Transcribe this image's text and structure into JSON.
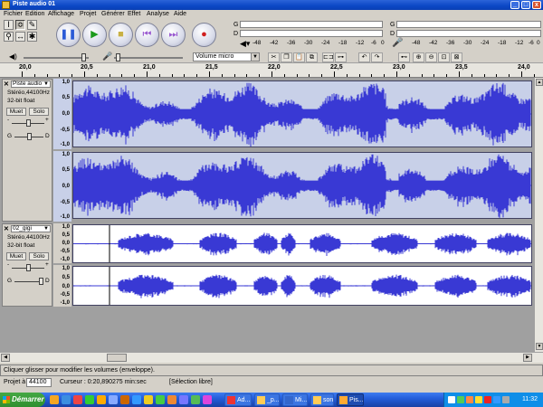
{
  "window": {
    "title": "Piste audio 01",
    "minimize": "_",
    "maximize": "□",
    "close": "x"
  },
  "menu": [
    "Fichier",
    "Edition",
    "Affichage",
    "Projet",
    "Générer",
    "Effet",
    "Analyse",
    "Aide"
  ],
  "transport": {
    "pause": "❚❚",
    "play": "▶",
    "stop": "■",
    "skip_start": "⏮",
    "skip_end": "⏭",
    "record": "●"
  },
  "meters": {
    "play_label": "G",
    "play_label2": "D",
    "rec_label": "G",
    "rec_label2": "D",
    "scale": [
      "-48",
      "-42",
      "-36",
      "-30",
      "-24",
      "-18",
      "-12",
      "-6",
      "0"
    ]
  },
  "mixer": {
    "input_source": "Volume micro"
  },
  "ruler": {
    "labels": [
      "20,0",
      "20,5",
      "21,0",
      "21,5",
      "22,0",
      "22,5",
      "23,0",
      "23,5",
      "24,0"
    ]
  },
  "tracks": [
    {
      "name": "Piste audio",
      "format": "Stéréo,44100Hz",
      "depth": "32-bit float",
      "mute": "Muet",
      "solo": "Solo",
      "pan_left": "G",
      "pan_right": "D",
      "gain_minus": "-",
      "gain_plus": "+",
      "scale": [
        "1,0",
        "0,5",
        "0,0",
        "-0,5",
        "-1,0"
      ]
    },
    {
      "name": "02_gigi",
      "format": "Stéréo,44100Hz",
      "depth": "32-bit float",
      "mute": "Muet",
      "solo": "Solo",
      "pan_left": "G",
      "pan_right": "D",
      "gain_minus": "-",
      "gain_plus": "+",
      "scale": [
        "1,0",
        "0,5",
        "0,0",
        "-0,5",
        "-1,0"
      ]
    }
  ],
  "status": {
    "message": "Cliquer glisser pour modifier les volumes (enveloppe)."
  },
  "bottom": {
    "rate_label": "Projet à",
    "rate_value": "44100",
    "cursor_text": "Curseur : 0:20,890275 min:sec",
    "selection_mode": "[Sélection libre]"
  },
  "taskbar": {
    "start": "Démarrer",
    "items": [
      "Ad...",
      "_p...",
      "Mi...",
      "son",
      "Pis..."
    ],
    "clock": "11:32"
  },
  "colors": {
    "waveform": "#3939d4",
    "waveform_bg": "#ffffff",
    "waveform_center": "#8a8ae6",
    "selected_track": "#c8d0e8"
  }
}
